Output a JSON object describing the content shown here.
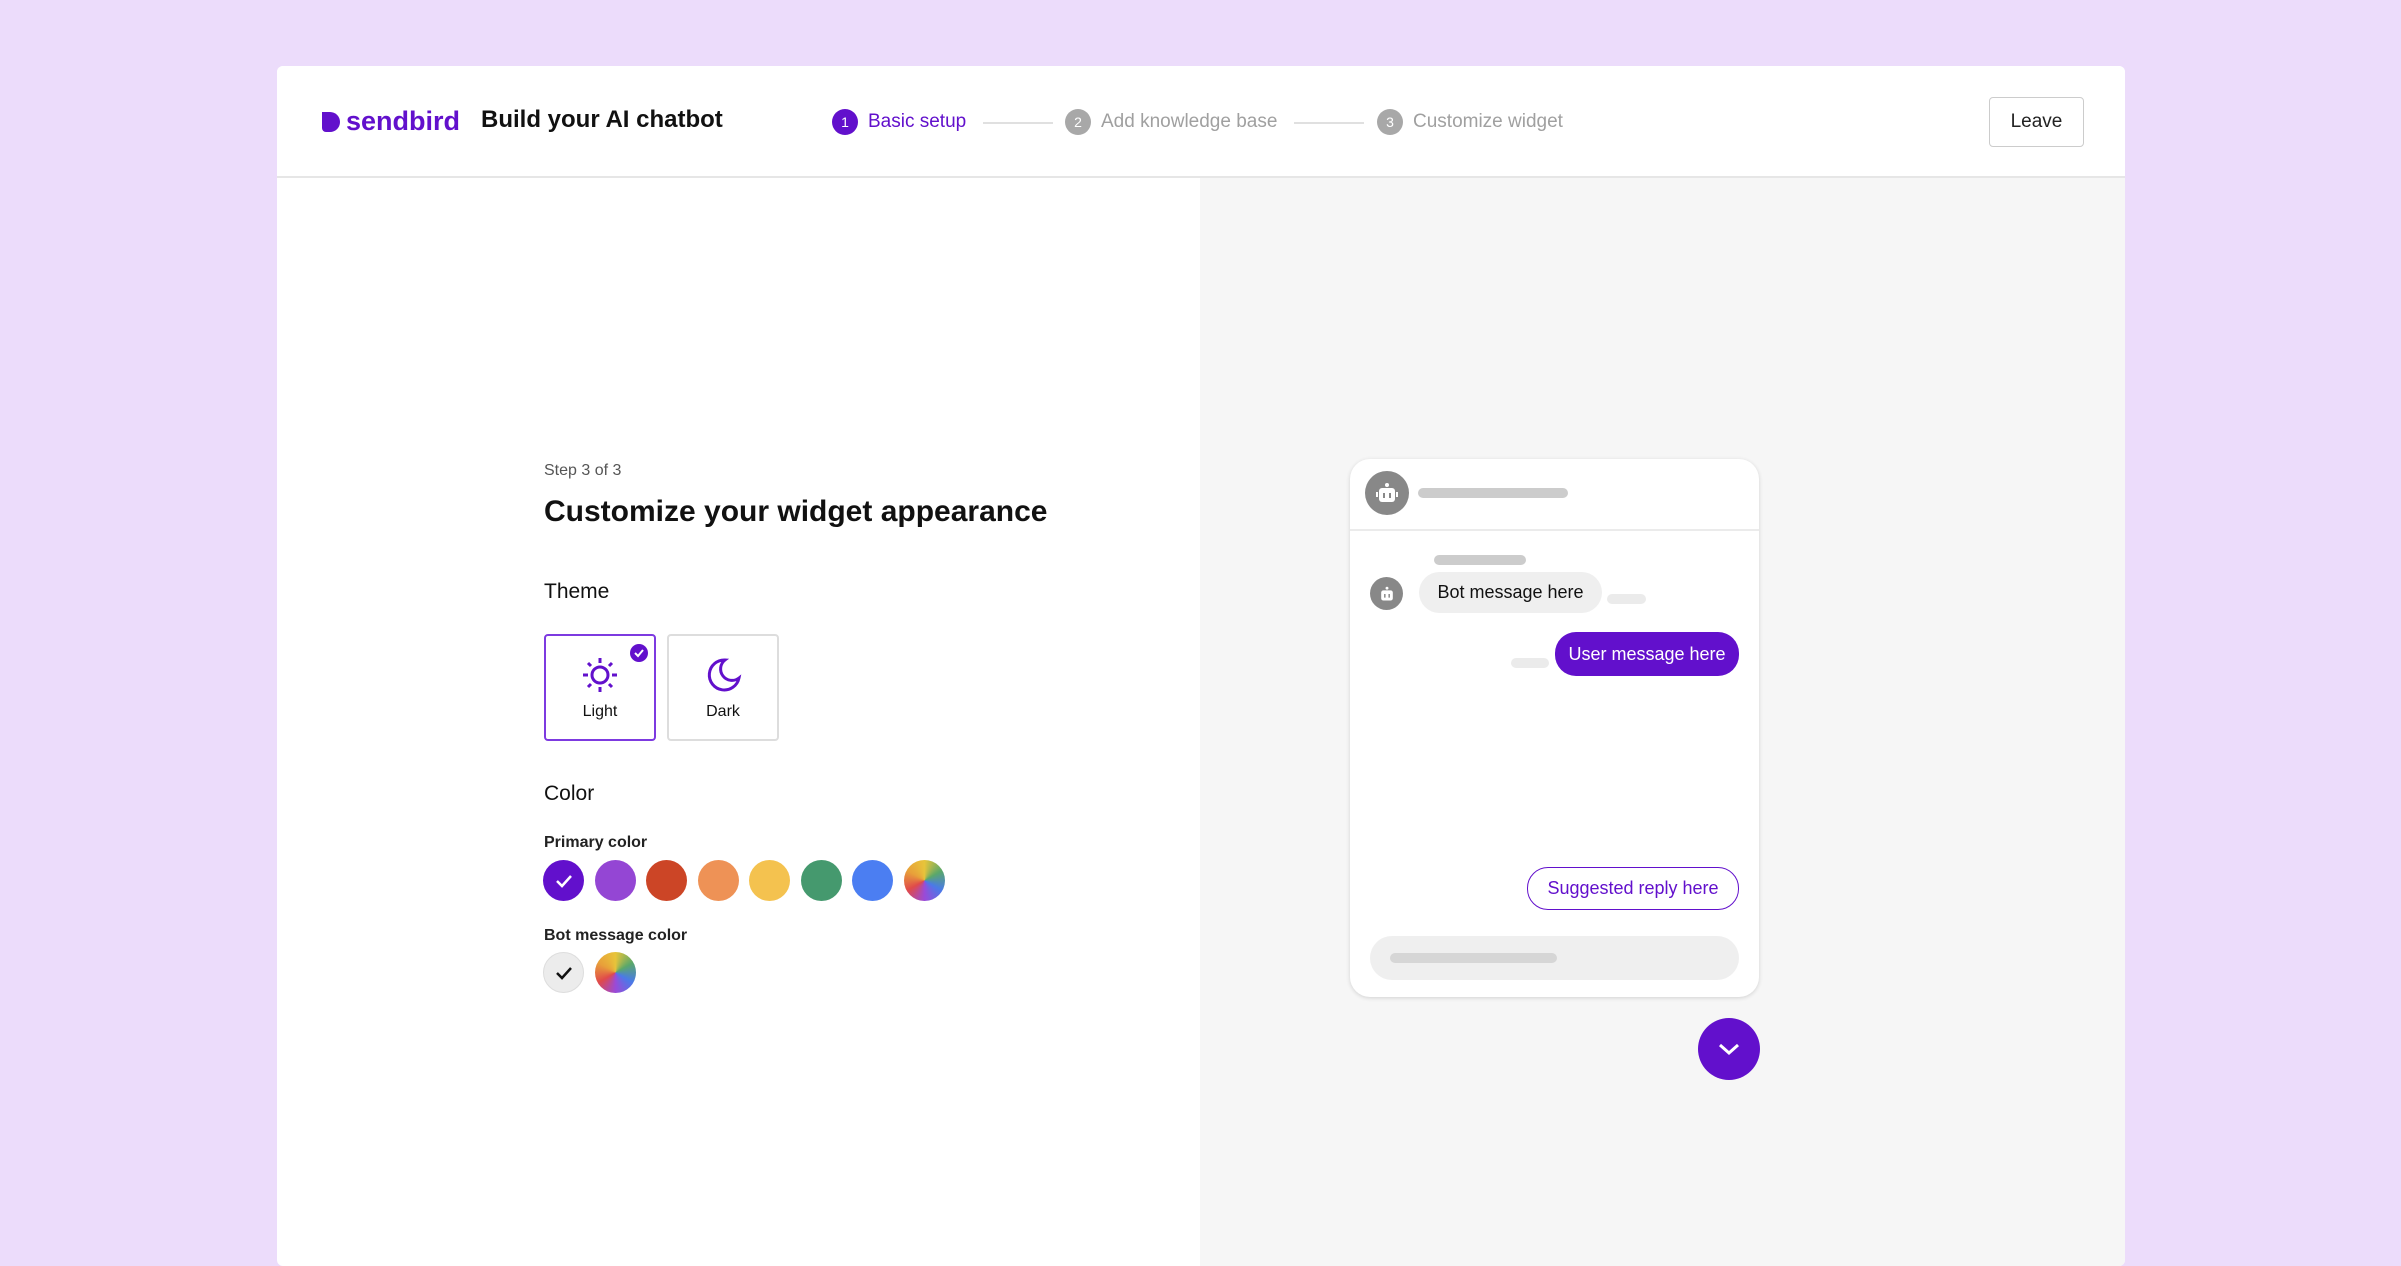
{
  "header": {
    "logo": "sendbird",
    "title": "Build your AI chatbot",
    "steps": [
      {
        "num": "1",
        "label": "Basic setup",
        "active": true
      },
      {
        "num": "2",
        "label": "Add knowledge base",
        "active": false
      },
      {
        "num": "3",
        "label": "Customize widget",
        "active": false
      }
    ],
    "leave_label": "Leave"
  },
  "form": {
    "step_label": "Step 3 of 3",
    "title": "Customize your widget appearance",
    "theme_label": "Theme",
    "themes": [
      {
        "label": "Light",
        "icon": "sun-icon",
        "selected": true
      },
      {
        "label": "Dark",
        "icon": "moon-icon",
        "selected": false
      }
    ],
    "color_label": "Color",
    "primary_color_label": "Primary color",
    "primary_colors": [
      "#6210cc",
      "#9446d4",
      "#cc4526",
      "#ee9256",
      "#f4c24f",
      "#45996e",
      "#4b7ef2",
      "rainbow"
    ],
    "primary_selected": 0,
    "bot_color_label": "Bot message color",
    "bot_colors": [
      "#ececec",
      "rainbow"
    ],
    "bot_selected": 0
  },
  "preview": {
    "bot_message": "Bot message here",
    "user_message": "User message here",
    "suggested_reply": "Suggested reply here",
    "accent": "#6210cc"
  }
}
